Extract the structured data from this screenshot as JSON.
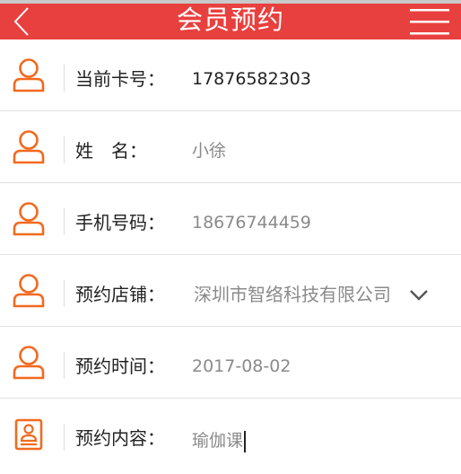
{
  "header": {
    "title": "会员预约",
    "color": "#e8403e"
  },
  "icons": {
    "back": "chevron-left-icon",
    "menu": "hamburger-menu-icon",
    "person": "person-icon",
    "content": "document-person-icon"
  },
  "accent_color": "#f26a1f",
  "form": {
    "card_number": {
      "label": "当前卡号：",
      "value": "17876582303"
    },
    "name": {
      "label": "姓　名：",
      "value": "小徐"
    },
    "phone": {
      "label": "手机号码：",
      "value": "18676744459"
    },
    "store": {
      "label": "预约店铺：",
      "value": "深圳市智络科技有限公司"
    },
    "time": {
      "label": "预约时间：",
      "value": "2017-08-02"
    },
    "content": {
      "label": "预约内容：",
      "value": "瑜伽课"
    }
  }
}
